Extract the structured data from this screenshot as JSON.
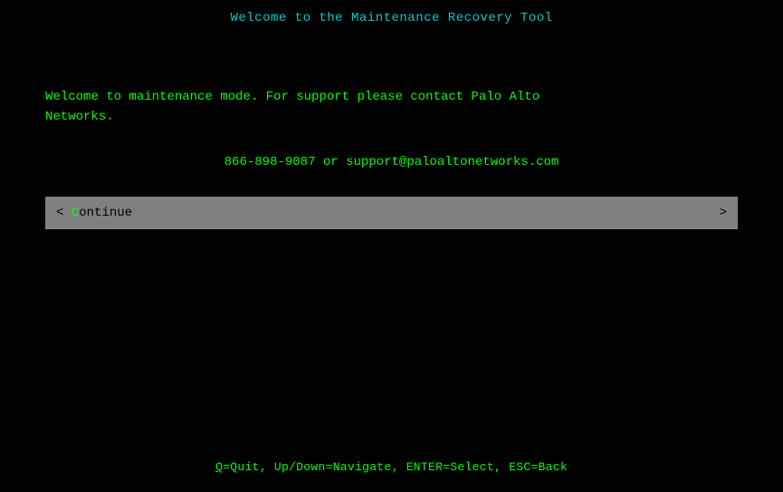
{
  "title": "Welcome to the Maintenance Recovery Tool",
  "content": {
    "welcome_line1": "Welcome to maintenance mode. For support please contact Palo Alto",
    "welcome_line2": "Networks.",
    "contact": "866-898-9087 or support@paloaltonetworks.com"
  },
  "button": {
    "left_bracket": "< ",
    "highlight_char": "C",
    "label_rest": "ontinue",
    "right_bracket": " >"
  },
  "footer": {
    "text": "Q=Quit,  Up/Down=Navigate,   ENTER=Select,  ESC=Back"
  }
}
